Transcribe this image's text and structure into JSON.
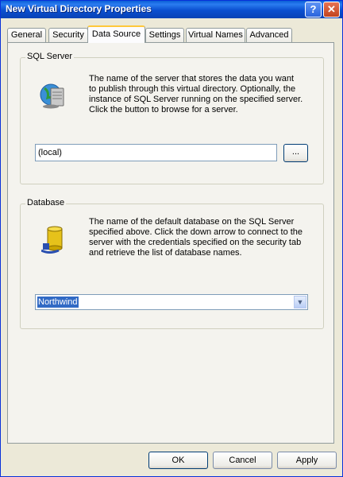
{
  "window": {
    "title": "New Virtual Directory Properties",
    "help_glyph": "?",
    "close_glyph": "✕"
  },
  "tabs": [
    {
      "label": "General",
      "active": false
    },
    {
      "label": "Security",
      "active": false
    },
    {
      "label": "Data Source",
      "active": true
    },
    {
      "label": "Settings",
      "active": false
    },
    {
      "label": "Virtual Names",
      "active": false
    },
    {
      "label": "Advanced",
      "active": false
    }
  ],
  "sql_server": {
    "group_label": "SQL Server",
    "icon": "server-icon",
    "description": "The name of the server that stores the data you want to publish through this virtual directory.  Optionally, the instance of SQL Server running on the specified server.  Click the button to browse for a server.",
    "value": "(local)",
    "browse_label": "..."
  },
  "database": {
    "group_label": "Database",
    "icon": "database-icon",
    "description": "The name of the default database on the SQL Server specified above.  Click the down arrow to connect to the server with the credentials specified on the security tab and retrieve the list of database names.",
    "value": "Northwind",
    "arrow_glyph": "▼"
  },
  "buttons": {
    "ok": "OK",
    "cancel": "Cancel",
    "apply": "Apply"
  },
  "colors": {
    "titlebar": "#0a4fd0",
    "face": "#ece9d8",
    "selection": "#316ac5",
    "active_tab_accent": "#ffc83c"
  }
}
